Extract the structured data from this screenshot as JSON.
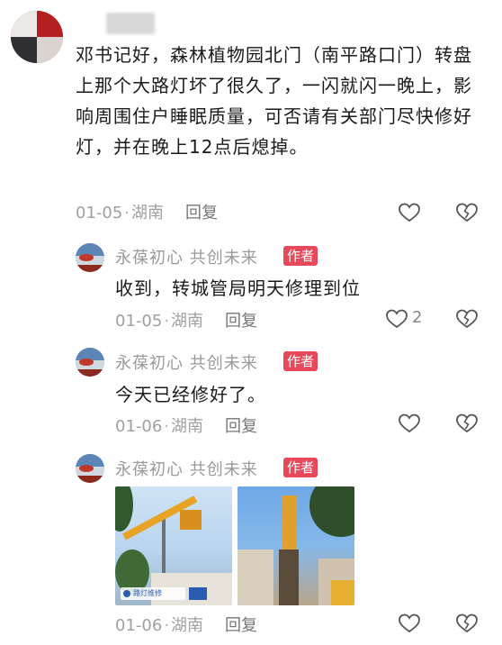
{
  "top_comment": {
    "text": "邓书记好，森林植物园北门（南平路口门）转盘上那个大路灯坏了很久了，一闪就闪一晚上，影响周围住户睡眠质量，可否请有关部门尽快修好灯，并在晚上12点后熄掉。",
    "date": "01-05",
    "location": "湖南",
    "reply_label": "回复"
  },
  "replies": [
    {
      "username": "永葆初心  共创未来",
      "badge": "作者",
      "text": "收到，转城管局明天修理到位",
      "date": "01-05",
      "location": "湖南",
      "reply_label": "回复",
      "likes": "2"
    },
    {
      "username": "永葆初心  共创未来",
      "badge": "作者",
      "text": "今天已经修好了。",
      "date": "01-06",
      "location": "湖南",
      "reply_label": "回复",
      "likes": ""
    },
    {
      "username": "永葆初心  共创未来",
      "badge": "作者",
      "text": "",
      "date": "01-06",
      "location": "湖南",
      "reply_label": "回复",
      "likes": ""
    }
  ],
  "photo_watermark": "路灯维修",
  "meta_separator": "·",
  "icons": {
    "like": "heart-outline-icon",
    "dislike": "broken-heart-icon"
  },
  "colors": {
    "author_badge": "#e8495a",
    "meta_text": "#9a9a9a",
    "icon_stroke": "#555555"
  }
}
